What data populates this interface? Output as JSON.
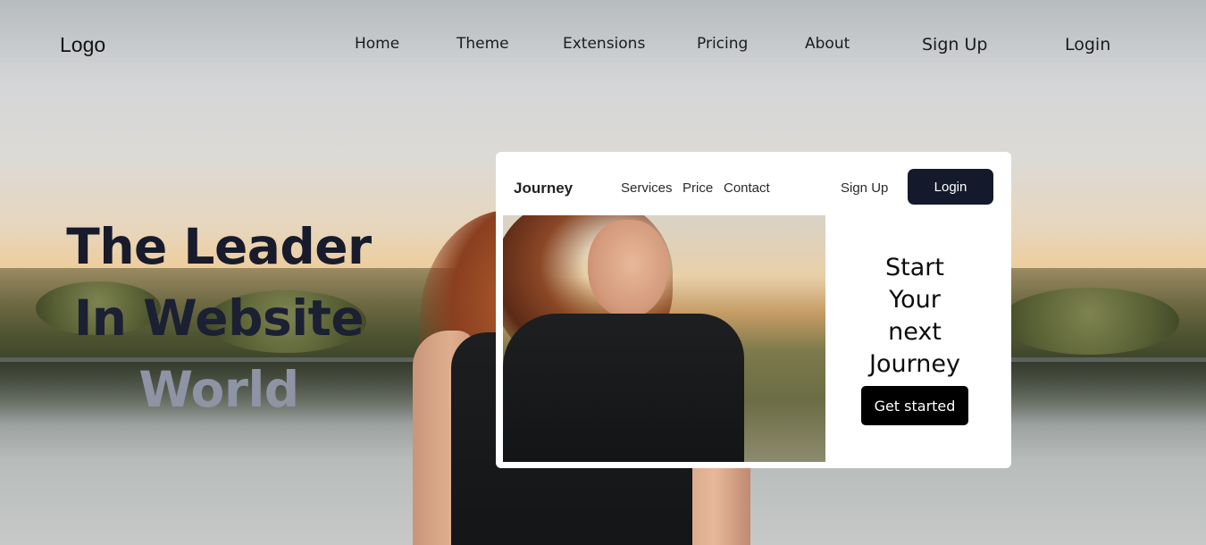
{
  "brand": {
    "logo": "Logo"
  },
  "nav": {
    "items": [
      "Home",
      "Theme",
      "Extensions",
      "Pricing",
      "About"
    ],
    "sign_up": "Sign Up",
    "login": "Login"
  },
  "hero": {
    "line1": "The Leader",
    "line2": "In Website",
    "line3": "World"
  },
  "card": {
    "brand": "Journey",
    "links": [
      "Services",
      "Price",
      "Contact"
    ],
    "sign_up": "Sign Up",
    "login": "Login",
    "headline": [
      "Start",
      "Your",
      "next",
      "Journey"
    ],
    "cta": "Get started"
  },
  "colors": {
    "hero_dark": "#171b2b",
    "hero_muted": "#8e94a4",
    "login_button": "#141a2b",
    "cta_button": "#000000"
  }
}
